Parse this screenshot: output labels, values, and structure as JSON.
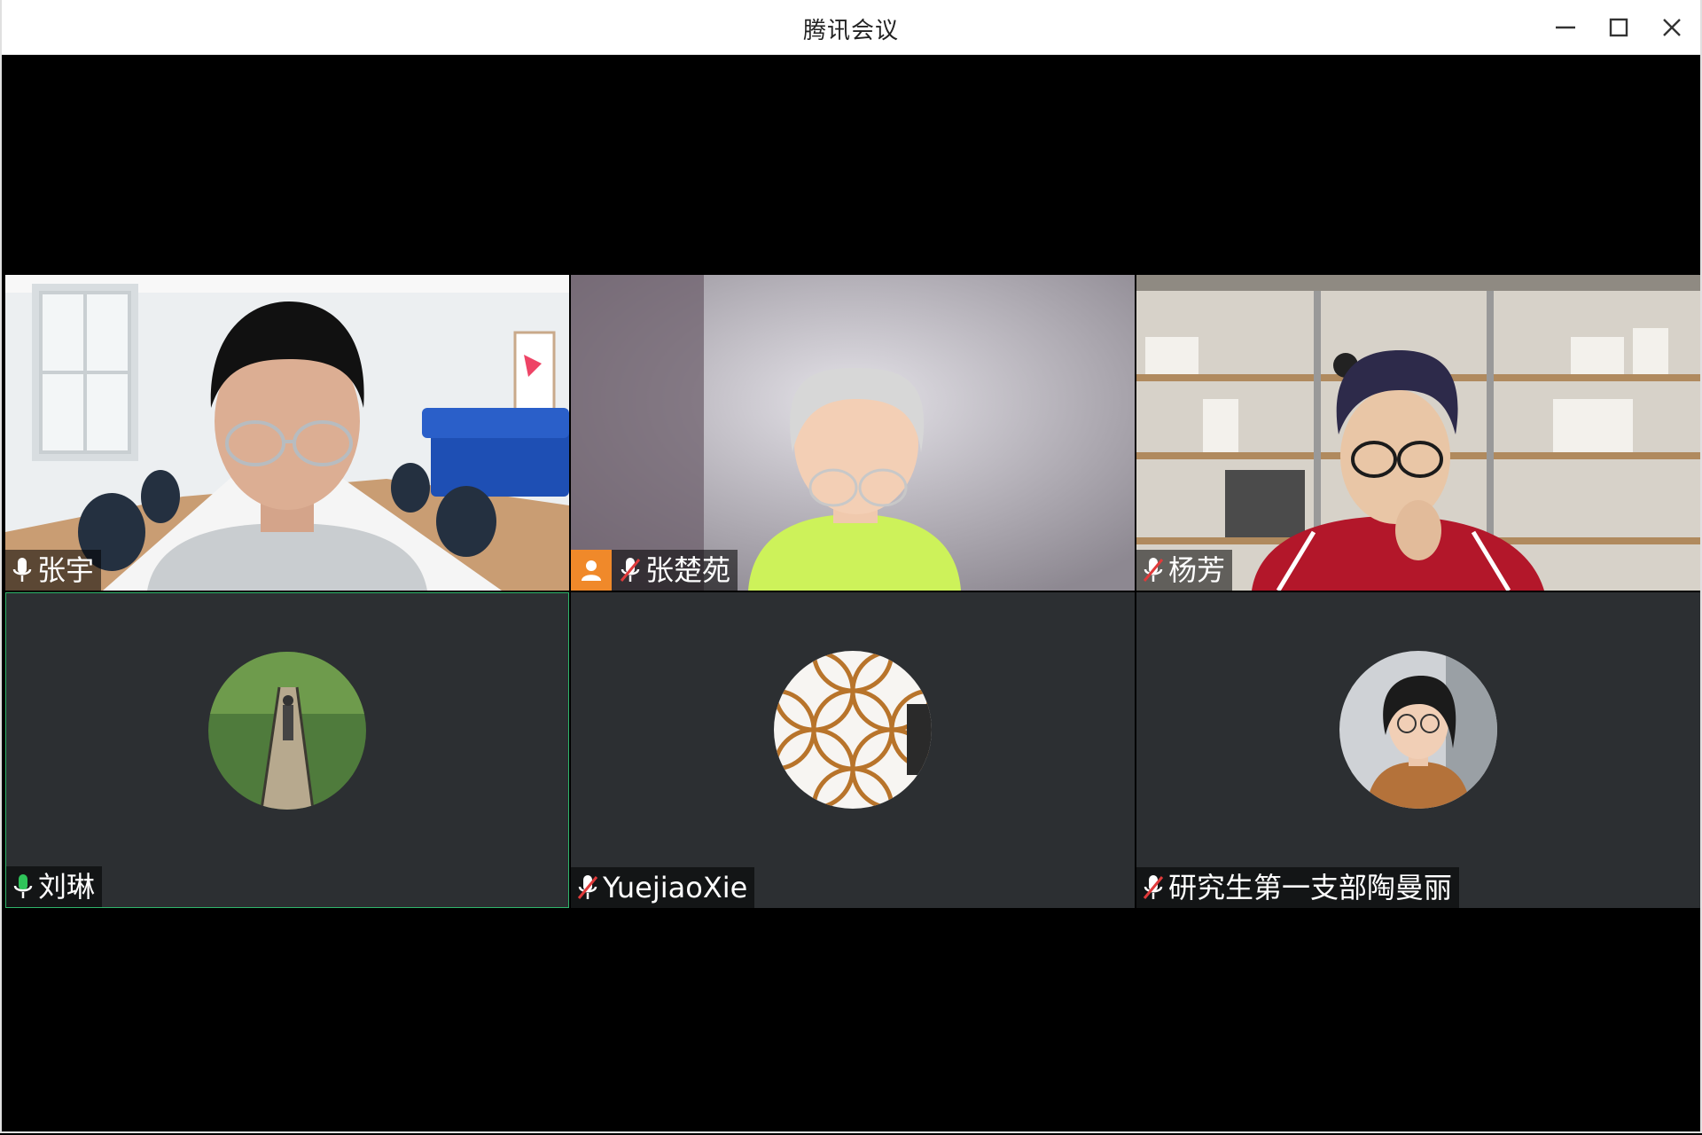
{
  "window": {
    "title": "腾讯会议",
    "controls": [
      "minimize-icon",
      "maximize-icon",
      "close-icon"
    ]
  },
  "colors": {
    "tile_bg": "#2c2f32",
    "active_speaker_border": "#2fb56a",
    "mic_active": "#2fc45a",
    "mic_muted": "#e03a3a",
    "host_badge": "#f0892a"
  },
  "participants": [
    {
      "name": "张宇",
      "video": "on",
      "mic": "on",
      "mic_icon": "microphone-icon"
    },
    {
      "name": "张楚苑",
      "video": "on",
      "mic": "muted",
      "host": true,
      "mic_icon": "microphone-muted-icon",
      "badge_icon": "person-icon"
    },
    {
      "name": "杨芳",
      "video": "on",
      "mic": "muted",
      "mic_icon": "microphone-muted-icon"
    },
    {
      "name": "刘琳",
      "video": "off",
      "mic": "speaking",
      "active_speaker": true,
      "mic_icon": "microphone-icon"
    },
    {
      "name": "YuejiaoXie",
      "video": "off",
      "mic": "muted",
      "mic_icon": "microphone-muted-icon"
    },
    {
      "name": "研究生第一支部陶曼丽",
      "video": "off",
      "mic": "muted",
      "mic_icon": "microphone-muted-icon"
    }
  ]
}
